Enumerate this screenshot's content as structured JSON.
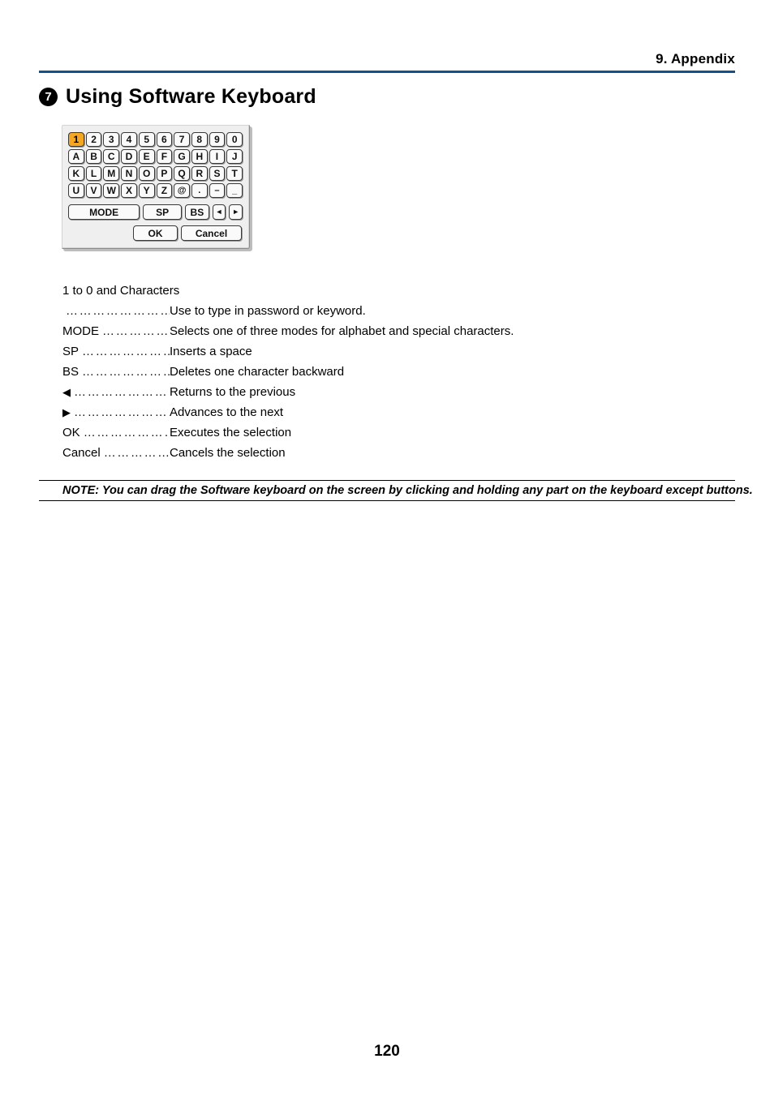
{
  "header": {
    "chapter_title": "9. Appendix",
    "rule_color": "#14518C"
  },
  "section": {
    "bullet": "7",
    "title": "Using Software Keyboard"
  },
  "keyboard": {
    "selected_key": "1",
    "selected_color": "#F5A623",
    "panel_bg": "#EFEFEF",
    "key_bg": "#FAFAFA",
    "rows": [
      [
        "1",
        "2",
        "3",
        "4",
        "5",
        "6",
        "7",
        "8",
        "9",
        "0"
      ],
      [
        "A",
        "B",
        "C",
        "D",
        "E",
        "F",
        "G",
        "H",
        "I",
        "J"
      ],
      [
        "K",
        "L",
        "M",
        "N",
        "O",
        "P",
        "Q",
        "R",
        "S",
        "T"
      ],
      [
        "U",
        "V",
        "W",
        "X",
        "Y",
        "Z",
        "@",
        ".",
        "–",
        "_"
      ]
    ],
    "function_row": {
      "mode": "MODE",
      "sp": "SP",
      "bs": "BS",
      "left_arrow": "◄",
      "right_arrow": "►"
    },
    "confirm_row": {
      "ok": "OK",
      "cancel": "Cancel"
    }
  },
  "definitions": {
    "intro_line": "1 to 0 and Characters",
    "items": [
      {
        "term": "",
        "leader": "………………………",
        "desc": "Use to type in password or keyword."
      },
      {
        "term": "MODE",
        "leader": "…………………",
        "desc": "Selects one of three modes for alphabet and special characters."
      },
      {
        "term": "SP",
        "leader": "……………………",
        "desc": "Inserts a space"
      },
      {
        "term": "BS",
        "leader": "……………………",
        "desc": "Deletes one character backward"
      },
      {
        "term": "◀",
        "leader": "……………………",
        "desc": "Returns to the previous"
      },
      {
        "term": "▶",
        "leader": "……………………",
        "desc": "Advances to the next"
      },
      {
        "term": "OK",
        "leader": "……………………",
        "desc": "Executes the selection"
      },
      {
        "term": "Cancel",
        "leader": "………………",
        "desc": "Cancels the selection"
      }
    ]
  },
  "note": {
    "text": "NOTE: You can drag the Software keyboard on the screen by clicking and holding any part on the keyboard except buttons."
  },
  "footer": {
    "page_number": "120"
  }
}
